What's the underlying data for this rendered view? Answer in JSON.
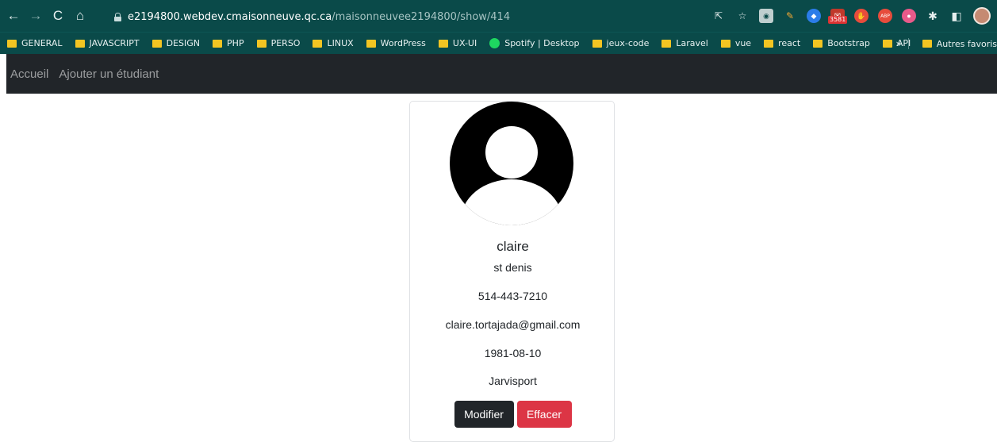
{
  "browser": {
    "url_host": "e2194800.webdev.cmaisonneuve.qc.ca",
    "url_path": "/maisonneuvee2194800/show/414",
    "extension_badge": "3581",
    "bookmarks": [
      "GENERAL",
      "JAVASCRIPT",
      "DESIGN",
      "PHP",
      "PERSO",
      "LINUX",
      "WordPress",
      "UX-UI",
      "Spotify | Desktop",
      "jeux-code",
      "Laravel",
      "vue",
      "react",
      "Bootstrap",
      "API"
    ],
    "more_bookmarks": "»",
    "other_bookmarks": "Autres favoris"
  },
  "nav": {
    "home": "Accueil",
    "add_student": "Ajouter un étudiant"
  },
  "student": {
    "name": "claire",
    "address": "st denis",
    "phone": "514-443-7210",
    "email": "claire.tortajada@gmail.com",
    "birthdate": "1981-08-10",
    "city": "Jarvisport"
  },
  "actions": {
    "edit": "Modifier",
    "delete": "Effacer"
  },
  "colors": {
    "chrome": "#0a4a49",
    "navbar": "#212529",
    "danger": "#dc3545",
    "folder": "#f3c522"
  }
}
